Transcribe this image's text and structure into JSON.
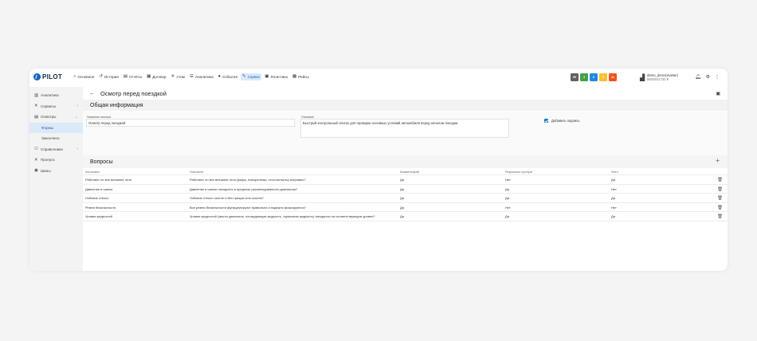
{
  "app": {
    "logo_text": "PILOT"
  },
  "nav": [
    {
      "label": "Основное",
      "icon": "home-icon",
      "glyph": "⌂",
      "active": false
    },
    {
      "label": "История",
      "icon": "history-icon",
      "glyph": "↺",
      "active": false
    },
    {
      "label": "Отчёты",
      "icon": "report-icon",
      "glyph": "▤",
      "active": false
    },
    {
      "label": "Договор",
      "icon": "contract-icon",
      "glyph": "▦",
      "active": false
    },
    {
      "label": "Атом",
      "icon": "atom-icon",
      "glyph": "✳",
      "active": false
    },
    {
      "label": "Аналитика",
      "icon": "analytics-icon",
      "glyph": "☰",
      "active": false
    },
    {
      "label": "События",
      "icon": "bell-icon",
      "glyph": "●",
      "active": false
    },
    {
      "label": "Сервис",
      "icon": "wrench-icon",
      "glyph": "✎",
      "active": true
    },
    {
      "label": "Логистика",
      "icon": "logistics-icon",
      "glyph": "▣",
      "active": false
    },
    {
      "label": "Рейсы",
      "icon": "bus-icon",
      "glyph": "▩",
      "active": false
    }
  ],
  "badges": [
    {
      "label": "99",
      "color": "#616161"
    },
    {
      "label": "3",
      "color": "#43a047"
    },
    {
      "label": "6",
      "color": "#1e88e5"
    },
    {
      "label": "9",
      "color": "#fbc02d"
    },
    {
      "label": "41",
      "color": "#f4511e"
    }
  ],
  "user": {
    "name": "demo_demo(master)",
    "balance": "8602641730 ₽"
  },
  "sidebar": [
    {
      "label": "Аналитика",
      "glyph": "▥",
      "icon": "analytics-icon",
      "chevron": false,
      "sub": false,
      "selected": false
    },
    {
      "label": "Сервисы",
      "glyph": "✕",
      "icon": "tools-icon",
      "chevron": true,
      "sub": false,
      "selected": false
    },
    {
      "label": "Осмотры",
      "glyph": "▤",
      "icon": "clipboard-icon",
      "chevron": true,
      "sub": false,
      "selected": false
    },
    {
      "label": "Формы",
      "glyph": "",
      "icon": "",
      "chevron": false,
      "sub": true,
      "selected": true
    },
    {
      "label": "Законченo",
      "glyph": "",
      "icon": "",
      "chevron": false,
      "sub": true,
      "selected": false
    },
    {
      "label": "Справочники",
      "glyph": "⚇",
      "icon": "directory-icon",
      "chevron": true,
      "sub": false,
      "selected": false
    },
    {
      "label": "Пропуск",
      "glyph": "✕",
      "icon": "pass-icon",
      "chevron": false,
      "sub": false,
      "selected": false
    },
    {
      "label": "Шины",
      "glyph": "◉",
      "icon": "tire-icon",
      "chevron": false,
      "sub": false,
      "selected": false
    }
  ],
  "page": {
    "title": "Осмотр перед поездкой",
    "general_title": "Общая информация",
    "name_label": "Название осмотра",
    "name_value": "Осмотр перед поездкой",
    "desc_label": "Описание",
    "desc_value": "Быстрый контрольный список для проверки основных условий автомобиля перед началом поездки.",
    "signature_label": "Добавить подпись",
    "questions_title": "Вопросы",
    "add_symbol": "+"
  },
  "table": {
    "headers": [
      "Заголовок",
      "Описание",
      "Комментарий",
      "Разрешить пропуск",
      "Фото"
    ],
    "rows": [
      [
        "Работают ли все внешние огни",
        "Работают ли все внешние огни (фары, поворотники, стоп-сигналы) исправно?",
        "Да",
        "Нет",
        "Да"
      ],
      [
        "Давление в шинах",
        "Давление в шинах находится в пределах рекомендованного диапазона?",
        "Да",
        "Да",
        "Нет"
      ],
      [
        "Лобовое стекло",
        "Лобовое стекло чистое и без трещин или сколов?",
        "Да",
        "Да",
        "Да"
      ],
      [
        "Ремни безопасности",
        "Все ремни безопасности функционируют правильно и надежно фиксируются?",
        "Да",
        "Нет",
        "Нет"
      ],
      [
        "Уровни жидкостей",
        "Уровни жидкостей (масло двигателя, охлаждающая жидкость, тормозная жидкость) находятся на соответствующем уровне?",
        "Да",
        "Да",
        "Да"
      ]
    ]
  }
}
